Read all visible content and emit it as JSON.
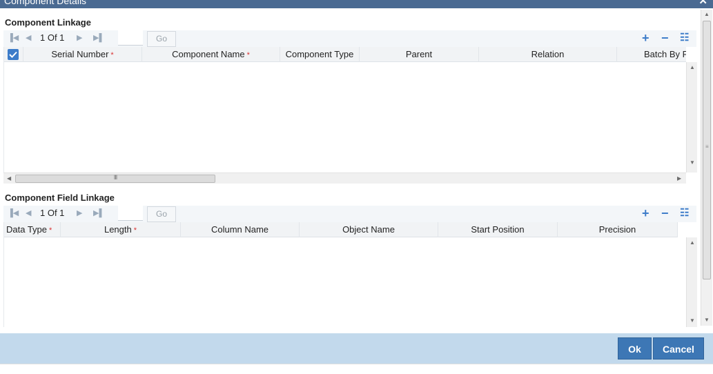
{
  "window": {
    "title": "Component Details",
    "close_label": "✕"
  },
  "component_linkage": {
    "title": "Component Linkage",
    "pagination": {
      "first": "▐◀",
      "prev": "◀",
      "info": "1 Of 1",
      "next": "▶",
      "last": "▶▌",
      "input_value": "",
      "go_label": "Go"
    },
    "tools": {
      "add": "+",
      "remove": "−",
      "view": "☷"
    },
    "columns": [
      {
        "label": "Serial Number",
        "required": "*"
      },
      {
        "label": "Component Name",
        "required": "*"
      },
      {
        "label": "Component Type",
        "required": ""
      },
      {
        "label": "Parent",
        "required": ""
      },
      {
        "label": "Relation",
        "required": ""
      },
      {
        "label": "Batch By F",
        "required": ""
      }
    ],
    "scroll": {
      "up": "▲",
      "down": "▼",
      "left": "◀",
      "right": "▶",
      "grip": "III"
    }
  },
  "component_field_linkage": {
    "title": "Component Field Linkage",
    "pagination": {
      "first": "▐◀",
      "prev": "◀",
      "info": "1 Of 1",
      "next": "▶",
      "last": "▶▌",
      "input_value": "",
      "go_label": "Go"
    },
    "tools": {
      "add": "+",
      "remove": "−",
      "view": "☷"
    },
    "columns": [
      {
        "label": "Data Type",
        "required": "*"
      },
      {
        "label": "Length",
        "required": "*"
      },
      {
        "label": "Column Name",
        "required": ""
      },
      {
        "label": "Object Name",
        "required": ""
      },
      {
        "label": "Start Position",
        "required": ""
      },
      {
        "label": "Precision",
        "required": ""
      }
    ],
    "scroll": {
      "up": "▲",
      "down": "▼"
    }
  },
  "outer_scroll": {
    "up": "▲",
    "down": "▼",
    "grip": "≡"
  },
  "footer": {
    "ok_label": "Ok",
    "cancel_label": "Cancel"
  },
  "colors": {
    "accent": "#3d7cc9",
    "header": "#4a6a92",
    "footer": "#c2d9ec",
    "button": "#3d77b5"
  }
}
